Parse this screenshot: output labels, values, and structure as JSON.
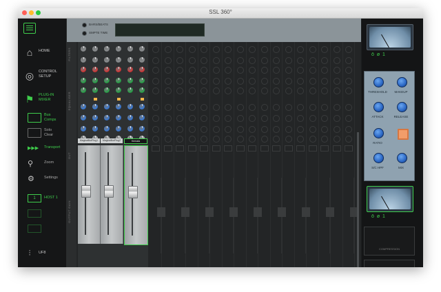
{
  "window": {
    "title": "SSL 360°"
  },
  "sidebar": {
    "items": [
      {
        "label": "HOME",
        "icon": "home-icon"
      },
      {
        "label": "CONTROL SETUP",
        "icon": "control-setup-icon"
      },
      {
        "label": "PLUG-IN MIXER",
        "icon": "plugin-mixer-icon"
      }
    ],
    "sub_items": [
      {
        "label": "Bus Comps",
        "icon": "bus-comps-icon"
      },
      {
        "label": "Solo Clear",
        "icon": "solo-clear-icon"
      },
      {
        "label": "Transport",
        "icon": "transport-icon",
        "icon_text": "▶▶▶"
      },
      {
        "label": "Zoom",
        "icon": "zoom-icon"
      },
      {
        "label": "Settings",
        "icon": "settings-icon"
      }
    ],
    "host": {
      "number": "1",
      "label": "HOST 1"
    },
    "ufe": {
      "label": "UF8",
      "icon": "uf8-faders-icon"
    }
  },
  "topbar": {
    "bars_beats": "BARS/BEATS",
    "smpte_time": "SMPTE TIME"
  },
  "section_labels": {
    "filters": "FILTERS",
    "equaliser": "EQUALISER",
    "out": "OUT",
    "output_gain": "OUTPUT GAIN"
  },
  "strips": [
    {
      "name": "MagicalBotPlug1"
    },
    {
      "name": "MagicalBotPlug2"
    },
    {
      "name": "Kemata"
    }
  ],
  "bus_comp": {
    "labels": {
      "threshold": "THRESHOLD",
      "makeup": "MAKEUP",
      "attack": "ATTACK",
      "release": "RELEASE",
      "ratio": "RATIO",
      "sc_hpf": "S/C HPF",
      "mix": "MIX"
    },
    "vu_labels": [
      "ō ø 1",
      "ō ø 1"
    ],
    "comp_caption": "COMPRESSION"
  },
  "colors": {
    "accent": "#3fce4c",
    "knob_blue": "#2b67c4",
    "led_orange": "#f3b64a"
  }
}
